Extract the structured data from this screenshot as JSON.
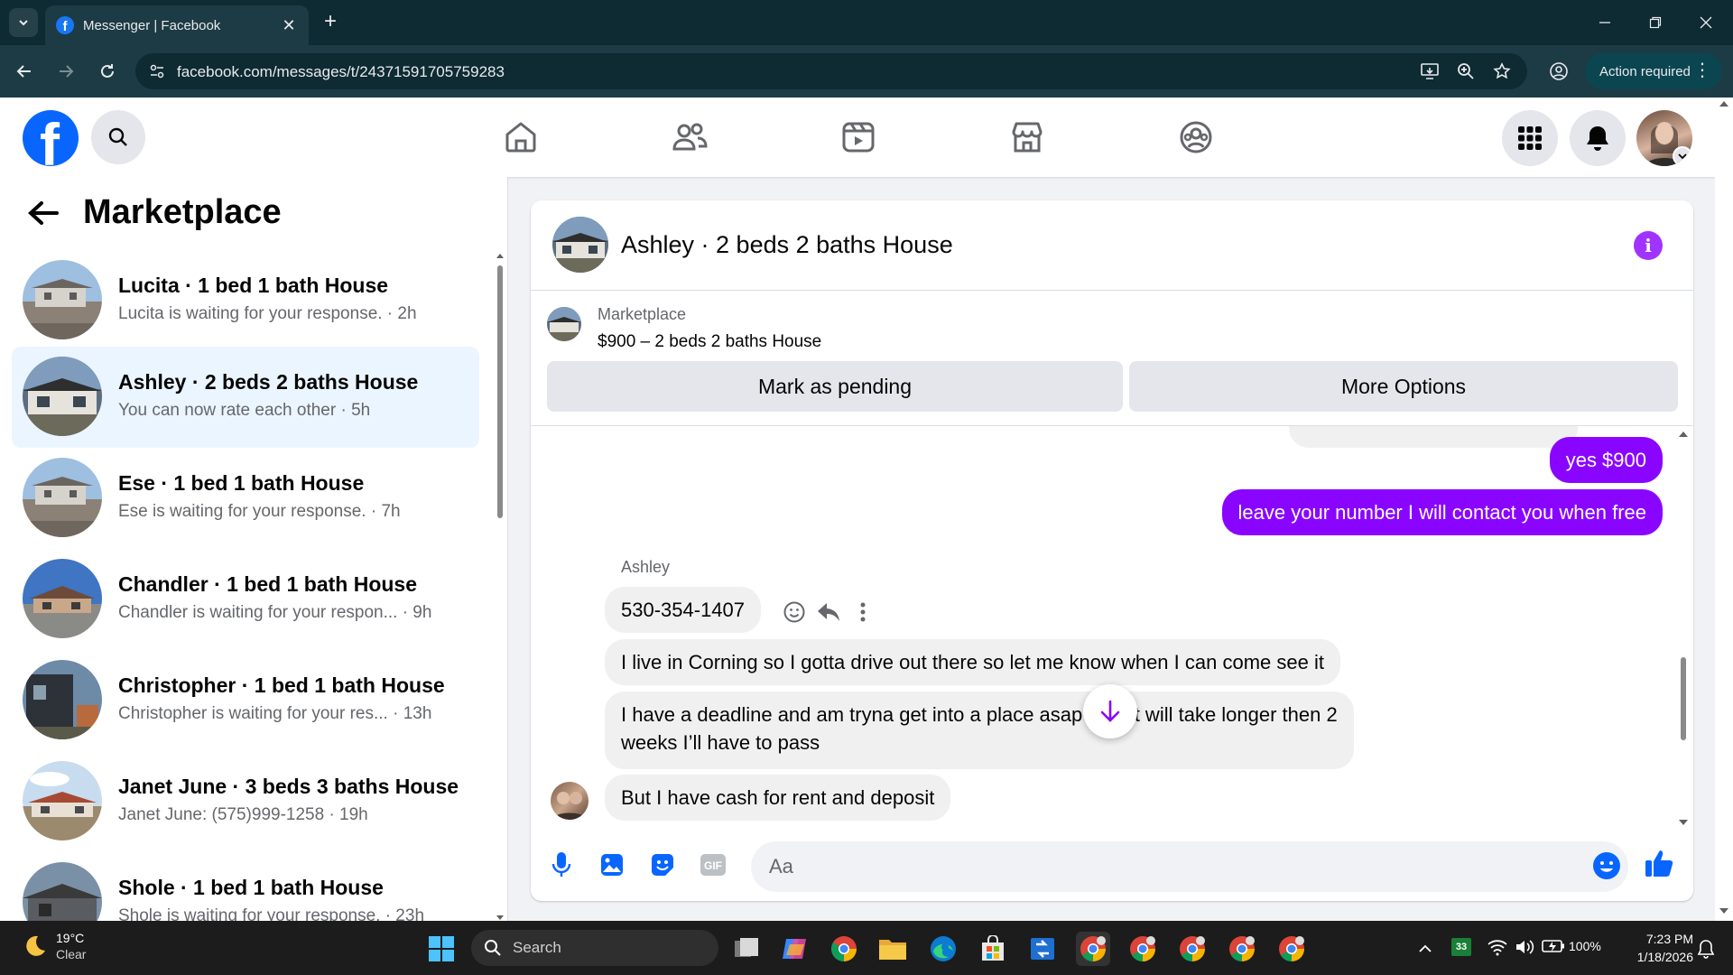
{
  "browser": {
    "tab_title": "Messenger | Facebook",
    "url": "facebook.com/messages/t/24371591705759283",
    "action_label": "Action required"
  },
  "sidebar": {
    "title": "Marketplace",
    "conversations": [
      {
        "name": "Lucita · 1 bed 1 bath House",
        "preview": "Lucita is waiting for your response. · 2h",
        "active": false
      },
      {
        "name": "Ashley · 2 beds 2 baths House",
        "preview": "You can now rate each other · 5h",
        "active": true
      },
      {
        "name": "Ese · 1 bed 1 bath House",
        "preview": "Ese is waiting for your response. · 7h",
        "active": false
      },
      {
        "name": "Chandler · 1 bed 1 bath House",
        "preview": "Chandler is waiting for your respon... · 9h",
        "active": false
      },
      {
        "name": "Christopher · 1 bed 1 bath House",
        "preview": "Christopher is waiting for your res... · 13h",
        "active": false
      },
      {
        "name": "Janet June · 3 beds 3 baths House",
        "preview": "Janet June: (575)999-1258 · 19h",
        "active": false
      },
      {
        "name": "Shole · 1 bed 1 bath House",
        "preview": "Shole is waiting for your response. · 23h",
        "active": false
      }
    ]
  },
  "chat": {
    "title": "Ashley · 2 beds 2 baths House",
    "marketplace_label": "Marketplace",
    "listing": "$900 – 2 beds 2 baths House",
    "mark_pending_label": "Mark as pending",
    "more_options_label": "More Options",
    "messages": [
      {
        "from": "me",
        "text": "yes $900"
      },
      {
        "from": "me",
        "text": "leave your number I will contact you when free"
      },
      {
        "from": "Ashley",
        "text": "530-354-1407"
      },
      {
        "from": "Ashley",
        "text": "I live in Corning so I gotta drive out there so let me know when I can come see it"
      },
      {
        "from": "Ashley",
        "text": "I have a deadline and am tryna get into a place asap so if it will take longer then 2"
      },
      {
        "from": "Ashley",
        "text": "weeks I’ll have to pass"
      },
      {
        "from": "Ashley",
        "text": "But I have cash for rent and deposit"
      }
    ],
    "sender_name": "Ashley",
    "composer_placeholder": "Aa",
    "gif_label": "GIF"
  },
  "taskbar": {
    "temperature": "19°C",
    "condition": "Clear",
    "search_label": "Search",
    "battery": "100%",
    "badge": "33",
    "time": "7:23 PM",
    "date": "1/18/2026"
  },
  "colors": {
    "accent_purple": "#8a05ff",
    "facebook_blue": "#0866ff",
    "browser_bg": "#0e2a33",
    "active_conv": "#ebf5ff"
  }
}
